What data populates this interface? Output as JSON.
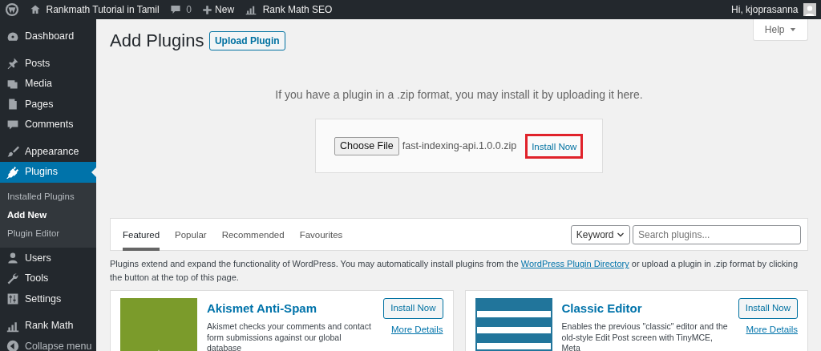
{
  "admin_bar": {
    "site_name": "Rankmath Tutorial in Tamil",
    "comments_count": "0",
    "new_label": "New",
    "seo_label": "Rank Math SEO",
    "greeting": "Hi, kjoprasanna"
  },
  "sidebar": {
    "groups": [
      [
        {
          "label": "Dashboard",
          "selected": false
        }
      ],
      [
        {
          "label": "Posts",
          "selected": false
        },
        {
          "label": "Media",
          "selected": false
        },
        {
          "label": "Pages",
          "selected": false
        },
        {
          "label": "Comments",
          "selected": false
        }
      ],
      [
        {
          "label": "Appearance",
          "selected": false
        },
        {
          "label": "Plugins",
          "selected": true,
          "children": [
            {
              "label": "Installed Plugins",
              "selected": false
            },
            {
              "label": "Add New",
              "selected": true
            },
            {
              "label": "Plugin Editor",
              "selected": false
            }
          ]
        },
        {
          "label": "Users",
          "selected": false
        },
        {
          "label": "Tools",
          "selected": false
        },
        {
          "label": "Settings",
          "selected": false
        }
      ],
      [
        {
          "label": "Rank Math",
          "selected": false
        },
        {
          "label": "Collapse menu",
          "selected": false
        }
      ]
    ]
  },
  "help_tab": "Help",
  "page_title": "Add Plugins",
  "upload_button": "Upload Plugin",
  "upload": {
    "instructions": "If you have a plugin in a .zip format, you may install it by uploading it here.",
    "choose_button": "Choose File",
    "file_name": "fast-indexing-api.1.0.0.zip",
    "install_button": "Install Now",
    "highlighted": true
  },
  "tabs": [
    {
      "label": "Featured",
      "selected": true
    },
    {
      "label": "Popular",
      "selected": false
    },
    {
      "label": "Recommended",
      "selected": false
    },
    {
      "label": "Favourites",
      "selected": false
    }
  ],
  "search": {
    "type_value": "Keyword",
    "placeholder": "Search plugins..."
  },
  "description": {
    "before": "Plugins extend and expand the functionality of WordPress. You may automatically install plugins from the ",
    "link": "WordPress Plugin Directory",
    "after": " or upload a plugin in .zip format by clicking the button at the top of this page."
  },
  "plugins": [
    {
      "name": "Akismet Anti-Spam",
      "description": "Akismet checks your comments and contact form submissions against our global database",
      "install": "Install Now",
      "details": "More Details",
      "color": "#7b9b2b"
    },
    {
      "name": "Classic Editor",
      "description": "Enables the previous \"classic\" editor and the old-style Edit Post screen with TinyMCE, Meta",
      "install": "Install Now",
      "details": "More Details",
      "color": "#21759b"
    }
  ]
}
